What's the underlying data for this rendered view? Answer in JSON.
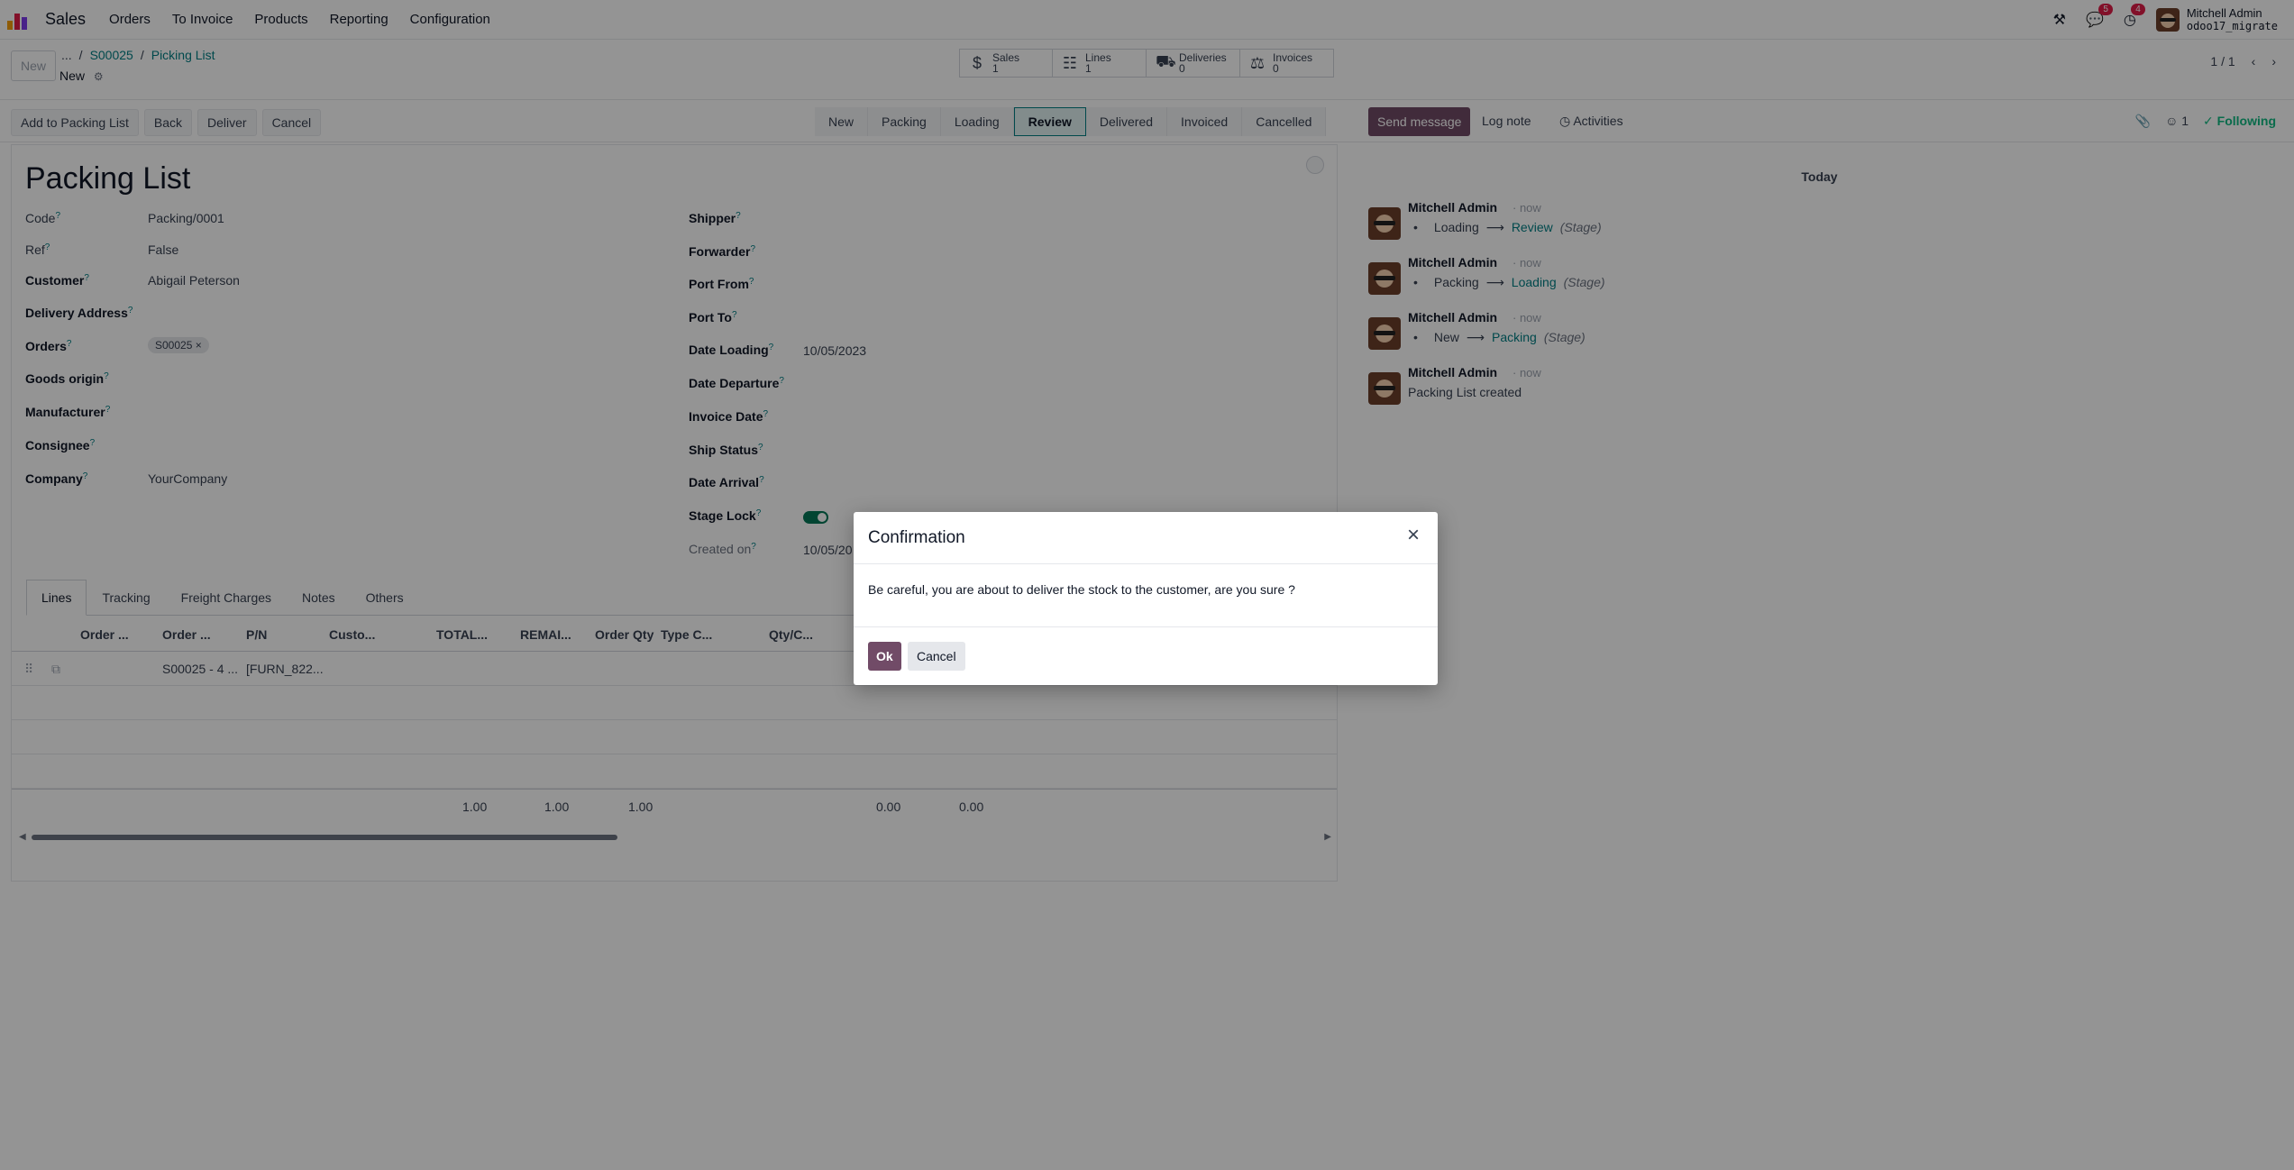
{
  "navbar": {
    "app_name": "Sales",
    "menus": [
      "Orders",
      "To Invoice",
      "Products",
      "Reporting",
      "Configuration"
    ],
    "chat_badge": "5",
    "activity_badge": "4",
    "user_name": "Mitchell Admin",
    "db_name": "odoo17_migrate"
  },
  "control": {
    "new_button": "New",
    "breadcrumb": [
      "...",
      "S00025",
      "Picking List"
    ],
    "record_state": "New",
    "smart_buttons": [
      {
        "label": "Sales",
        "count": "1",
        "icon": "dollar-icon"
      },
      {
        "label": "Lines",
        "count": "1",
        "icon": "sitemap-icon"
      },
      {
        "label": "Deliveries",
        "count": "0",
        "icon": "truck-icon"
      },
      {
        "label": "Invoices",
        "count": "0",
        "icon": "scale-icon"
      }
    ],
    "pager": "1 / 1"
  },
  "statusbar": {
    "actions": [
      "Add to Packing List",
      "Back",
      "Deliver",
      "Cancel"
    ],
    "stages": [
      "New",
      "Packing",
      "Loading",
      "Review",
      "Delivered",
      "Invoiced",
      "Cancelled"
    ],
    "active_stage": "Review"
  },
  "chatter_head": {
    "send_message": "Send message",
    "log_note": "Log note",
    "activities": "Activities",
    "followers": "1",
    "following": "Following"
  },
  "form": {
    "title": "Packing List",
    "left": {
      "code_label": "Code",
      "code_value": "Packing/0001",
      "ref_label": "Ref",
      "ref_value": "False",
      "customer_label": "Customer",
      "customer_value": "Abigail Peterson",
      "delivery_label": "Delivery Address",
      "orders_label": "Orders",
      "orders_tag": "S00025",
      "goods_label": "Goods origin",
      "manufacturer_label": "Manufacturer",
      "consignee_label": "Consignee",
      "company_label": "Company",
      "company_value": "YourCompany"
    },
    "right": {
      "shipper_label": "Shipper",
      "forwarder_label": "Forwarder",
      "port_from_label": "Port From",
      "port_to_label": "Port To",
      "date_loading_label": "Date Loading",
      "date_loading_value": "10/05/2023",
      "date_departure_label": "Date Departure",
      "invoice_date_label": "Invoice Date",
      "ship_status_label": "Ship Status",
      "date_arrival_label": "Date Arrival",
      "stage_lock_label": "Stage Lock",
      "created_on_label": "Created on",
      "created_on_value": "10/05/20"
    }
  },
  "notebook": {
    "tabs": [
      "Lines",
      "Tracking",
      "Freight Charges",
      "Notes",
      "Others"
    ],
    "columns": [
      "Order ...",
      "Order ...",
      "P/N",
      "Custo...",
      "TOTAL...",
      "REMAI...",
      "Order Qty",
      "Type C...",
      "Qty/C..."
    ],
    "row": {
      "order": "S00025 - 4 ...",
      "pn": "[FURN_822..."
    },
    "totals": [
      "1.00",
      "1.00",
      "1.00",
      "0.00",
      "0.00"
    ]
  },
  "chatter": {
    "today": "Today",
    "messages": [
      {
        "author": "Mitchell Admin",
        "time": "now",
        "old": "Loading",
        "new": "Review",
        "field": "(Stage)"
      },
      {
        "author": "Mitchell Admin",
        "time": "now",
        "old": "Packing",
        "new": "Loading",
        "field": "(Stage)"
      },
      {
        "author": "Mitchell Admin",
        "time": "now",
        "old": "New",
        "new": "Packing",
        "field": "(Stage)"
      },
      {
        "author": "Mitchell Admin",
        "time": "now",
        "text": "Packing List created"
      }
    ]
  },
  "modal": {
    "title": "Confirmation",
    "body": "Be careful, you are about to deliver the stock to the customer, are you sure ?",
    "ok": "Ok",
    "cancel": "Cancel"
  },
  "colors": {
    "brand": "#714b67",
    "link": "#017e84",
    "toggle": "#047857"
  }
}
